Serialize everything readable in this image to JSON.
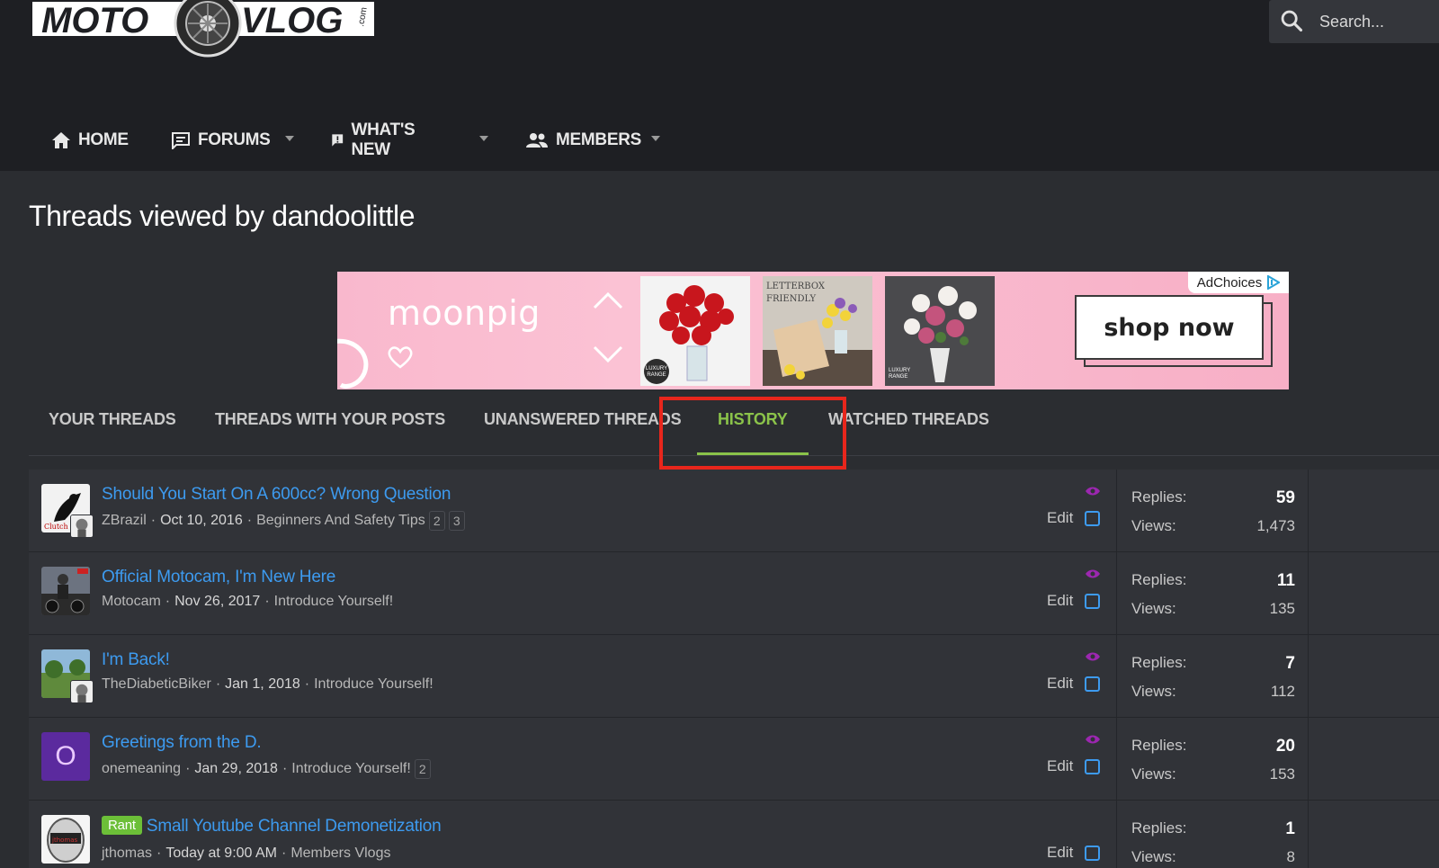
{
  "site": {
    "logo_text_left": "MOTO",
    "logo_text_right": "VLOG",
    "logo_suffix": ".com",
    "search_placeholder": "Search..."
  },
  "nav": {
    "items": [
      {
        "label": "HOME",
        "icon": "home-icon"
      },
      {
        "label": "FORUMS",
        "icon": "chat-icon"
      },
      {
        "label": "WHAT'S NEW",
        "icon": "alert-message-icon"
      },
      {
        "label": "MEMBERS",
        "icon": "people-icon"
      }
    ]
  },
  "page": {
    "title": "Threads viewed by dandoolittle"
  },
  "ad": {
    "brand": "moonpig",
    "cta": "shop now",
    "adchoices": "AdChoices",
    "badge": "LUXURY RANGE",
    "letterbox": "LETTERBOX FRIENDLY"
  },
  "tabs": [
    {
      "label": "YOUR THREADS",
      "active": false
    },
    {
      "label": "THREADS WITH YOUR POSTS",
      "active": false
    },
    {
      "label": "UNANSWERED THREADS",
      "active": false
    },
    {
      "label": "HISTORY",
      "active": true
    },
    {
      "label": "WATCHED THREADS",
      "active": false
    }
  ],
  "threads": [
    {
      "title": "Should You Start On A 600cc? Wrong Question",
      "prefix": "",
      "author": "ZBrazil",
      "date": "Oct 10, 2016",
      "forum": "Beginners And Safety Tips",
      "pages": [
        "2",
        "3"
      ],
      "edit": "Edit",
      "replies_label": "Replies:",
      "replies": "59",
      "views_label": "Views:",
      "views": "1,473"
    },
    {
      "title": "Official Motocam, I'm New Here",
      "prefix": "",
      "author": "Motocam",
      "date": "Nov 26, 2017",
      "forum": "Introduce Yourself!",
      "pages": [],
      "edit": "Edit",
      "replies_label": "Replies:",
      "replies": "11",
      "views_label": "Views:",
      "views": "135"
    },
    {
      "title": "I'm Back!",
      "prefix": "",
      "author": "TheDiabeticBiker",
      "date": "Jan 1, 2018",
      "forum": "Introduce Yourself!",
      "pages": [],
      "edit": "Edit",
      "replies_label": "Replies:",
      "replies": "7",
      "views_label": "Views:",
      "views": "112"
    },
    {
      "title": "Greetings from the D.",
      "prefix": "",
      "author": "onemeaning",
      "date": "Jan 29, 2018",
      "forum": "Introduce Yourself!",
      "pages": [
        "2"
      ],
      "edit": "Edit",
      "replies_label": "Replies:",
      "replies": "20",
      "views_label": "Views:",
      "views": "153",
      "avatar_letter": "O"
    },
    {
      "title": "Small Youtube Channel Demonetization",
      "prefix": "Rant",
      "author": "jthomas",
      "date": "Today at 9:00 AM",
      "forum": "Members Vlogs",
      "pages": [],
      "edit": "Edit",
      "replies_label": "Replies:",
      "replies": "1",
      "views_label": "Views:",
      "views": "8"
    }
  ],
  "colors": {
    "accent_green": "#8bc34a",
    "link_blue": "#3d9bf0",
    "highlight_red": "#e8261c",
    "watch_eye": "#9c27b0"
  }
}
